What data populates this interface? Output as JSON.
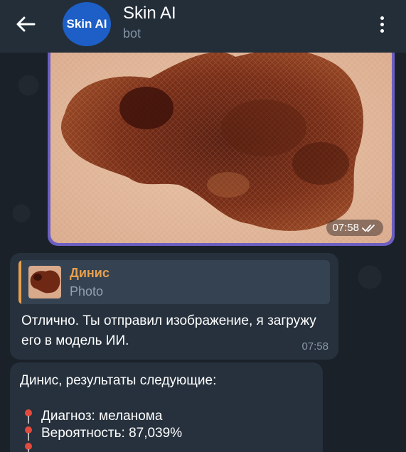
{
  "header": {
    "avatar_text": "Skin AI",
    "title": "Skin AI",
    "subtitle": "bot"
  },
  "photo_message": {
    "time": "07:58",
    "status": "read"
  },
  "reply_message": {
    "quote_name": "Динис",
    "quote_type": "Photo",
    "text": "Отлично. Ты отправил изображение, я загружу его в модель ИИ.",
    "time": "07:58"
  },
  "result_message": {
    "intro": "Динис, результаты следующие:",
    "lines": [
      "Диагноз: меланома",
      "Вероятность: 87,039%"
    ]
  },
  "colors": {
    "header_bg": "#242e39",
    "accent_bubble": "#6c5fc2",
    "incoming_bubble": "#26313d",
    "quote_accent": "#e7a04d",
    "avatar_bg": "#1d5fc6",
    "pin": "#e24a3d"
  },
  "icons": [
    "back-arrow-icon",
    "more-vertical-icon",
    "double-check-icon",
    "pin-icon"
  ]
}
